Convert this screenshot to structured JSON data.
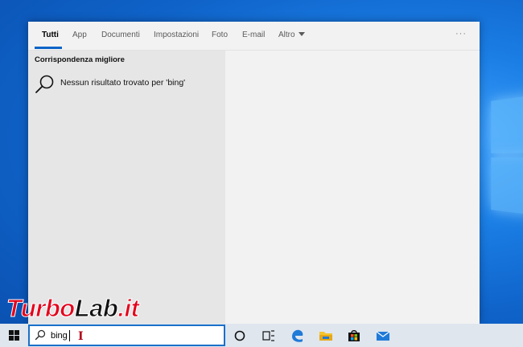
{
  "tabs": [
    {
      "label": "Tutti",
      "active": true
    },
    {
      "label": "App"
    },
    {
      "label": "Documenti"
    },
    {
      "label": "Impostazioni"
    },
    {
      "label": "Foto"
    },
    {
      "label": "E-mail"
    },
    {
      "label": "Altro"
    }
  ],
  "more_options_label": "···",
  "best_match": {
    "heading": "Corrispondenza migliore",
    "result_text": "Nessun risultato trovato per 'bing'",
    "result_icon": "search-icon"
  },
  "taskbar": {
    "search_value": "bing",
    "icons": [
      "windows-start-icon",
      "cortana-icon",
      "task-view-icon",
      "edge-icon",
      "file-explorer-icon",
      "store-icon",
      "mail-icon"
    ]
  },
  "watermark": {
    "part1": "Turbo",
    "part2": "Lab",
    "part3": ".it"
  },
  "colors": {
    "accent": "#0a64c8",
    "search_border": "#1a70c8",
    "watermark_red": "#e3001b"
  }
}
